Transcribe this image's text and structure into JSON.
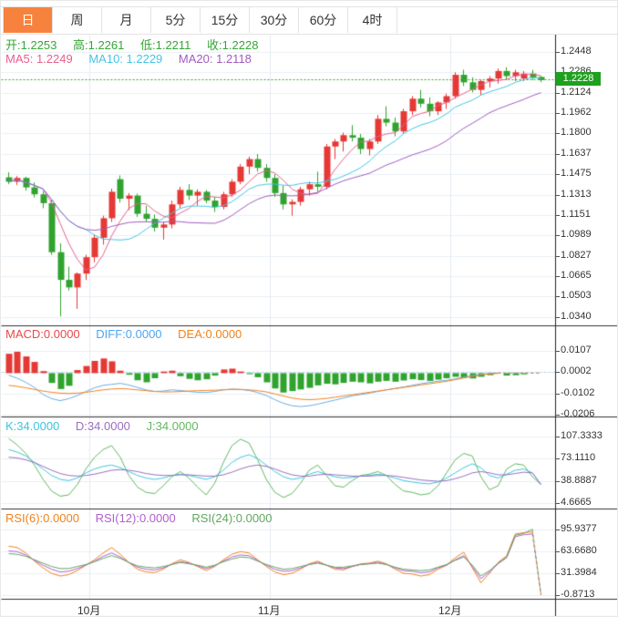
{
  "tabs": [
    {
      "label": "日",
      "active": true
    },
    {
      "label": "周",
      "active": false
    },
    {
      "label": "月",
      "active": false
    },
    {
      "label": "5分",
      "active": false
    },
    {
      "label": "15分",
      "active": false
    },
    {
      "label": "30分",
      "active": false
    },
    {
      "label": "60分",
      "active": false
    },
    {
      "label": "4时",
      "active": false
    }
  ],
  "info": {
    "open": "开:1.2253",
    "high": "高:1.2261",
    "low": "低:1.2211",
    "close": "收:1.2228",
    "ma5": "MA5: 1.2249",
    "ma10": "MA10: 1.2229",
    "ma20": "MA20: 1.2118"
  },
  "price_badge": "1.2228",
  "colors": {
    "up": "#e53935",
    "down": "#30a32f",
    "ma5": "#e8608e",
    "ma10": "#45c5e5",
    "ma20": "#a05bc0",
    "diff": "#6aabe8",
    "dea": "#f0821e",
    "k": "#3ec6dd",
    "d": "#9a6ec0",
    "j": "#61b861",
    "rsi6": "#f0821e",
    "rsi12": "#b05fd0",
    "rsi24": "#61a861",
    "grid": "#e9eff5",
    "vgrid": "#e4ebf2",
    "separator": "#333333",
    "axis_line": "#222222",
    "price_line": "#2ca52c",
    "badge": "#1fa01f",
    "tab_active": "#f7823e"
  },
  "chart_data": [
    {
      "type": "candlestick",
      "name": "price-panel",
      "y_axis_labels": [
        "1.2448",
        "1.2286",
        "1.2124",
        "1.1962",
        "1.1800",
        "1.1637",
        "1.1475",
        "1.1313",
        "1.1151",
        "1.0989",
        "1.0827",
        "1.0665",
        "1.0503",
        "1.0340"
      ],
      "ylim": [
        1.034,
        1.2448
      ],
      "current_price": 1.2228,
      "ma_periods": [
        5,
        10,
        20
      ],
      "x_ticks": [
        {
          "index": 10,
          "label": "10月"
        },
        {
          "index": 31,
          "label": "11月"
        },
        {
          "index": 52,
          "label": "12月"
        }
      ],
      "candles": [
        [
          1.1455,
          1.1495,
          1.14,
          1.142
        ],
        [
          1.142,
          1.1465,
          1.1395,
          1.145
        ],
        [
          1.145,
          1.146,
          1.135,
          1.1375
        ],
        [
          1.1375,
          1.1415,
          1.1295,
          1.132
        ],
        [
          1.132,
          1.1345,
          1.121,
          1.125
        ],
        [
          1.125,
          1.1275,
          1.0838,
          1.086
        ],
        [
          1.086,
          1.093,
          1.035,
          1.064
        ],
        [
          1.064,
          1.0745,
          1.0555,
          1.058
        ],
        [
          1.058,
          1.07,
          1.041,
          1.069
        ],
        [
          1.069,
          1.084,
          1.064,
          1.082
        ],
        [
          1.082,
          1.1,
          1.078,
          1.0975
        ],
        [
          1.0975,
          1.115,
          1.092,
          1.113
        ],
        [
          1.113,
          1.1365,
          1.11,
          1.134
        ],
        [
          1.144,
          1.147,
          1.1255,
          1.1285
        ],
        [
          1.1285,
          1.133,
          1.1195,
          1.131
        ],
        [
          1.131,
          1.1325,
          1.114,
          1.1165
        ],
        [
          1.1165,
          1.123,
          1.11,
          1.1125
        ],
        [
          1.1125,
          1.116,
          1.1025,
          1.1055
        ],
        [
          1.1055,
          1.11,
          1.096,
          1.108
        ],
        [
          1.108,
          1.127,
          1.105,
          1.124
        ],
        [
          1.124,
          1.138,
          1.121,
          1.1355
        ],
        [
          1.1355,
          1.14,
          1.1275,
          1.131
        ],
        [
          1.131,
          1.136,
          1.123,
          1.134
        ],
        [
          1.134,
          1.1355,
          1.125,
          1.127
        ],
        [
          1.127,
          1.13,
          1.118,
          1.122
        ],
        [
          1.122,
          1.134,
          1.12,
          1.132
        ],
        [
          1.132,
          1.144,
          1.13,
          1.142
        ],
        [
          1.142,
          1.156,
          1.14,
          1.154
        ],
        [
          1.154,
          1.162,
          1.148,
          1.16
        ],
        [
          1.16,
          1.164,
          1.15,
          1.153
        ],
        [
          1.153,
          1.156,
          1.142,
          1.145
        ],
        [
          1.145,
          1.148,
          1.13,
          1.133
        ],
        [
          1.133,
          1.139,
          1.12,
          1.124
        ],
        [
          1.124,
          1.128,
          1.115,
          1.126
        ],
        [
          1.126,
          1.138,
          1.123,
          1.136
        ],
        [
          1.136,
          1.142,
          1.131,
          1.14
        ],
        [
          1.14,
          1.15,
          1.134,
          1.138
        ],
        [
          1.138,
          1.172,
          1.136,
          1.17
        ],
        [
          1.17,
          1.176,
          1.16,
          1.174
        ],
        [
          1.174,
          1.181,
          1.166,
          1.179
        ],
        [
          1.179,
          1.187,
          1.174,
          1.177
        ],
        [
          1.177,
          1.18,
          1.164,
          1.168
        ],
        [
          1.168,
          1.176,
          1.163,
          1.174
        ],
        [
          1.174,
          1.195,
          1.172,
          1.192
        ],
        [
          1.192,
          1.202,
          1.186,
          1.189
        ],
        [
          1.189,
          1.193,
          1.178,
          1.182
        ],
        [
          1.182,
          1.2,
          1.18,
          1.198
        ],
        [
          1.198,
          1.21,
          1.195,
          1.208
        ],
        [
          1.208,
          1.215,
          1.201,
          1.204
        ],
        [
          1.204,
          1.209,
          1.194,
          1.198
        ],
        [
          1.198,
          1.206,
          1.195,
          1.205
        ],
        [
          1.205,
          1.212,
          1.2,
          1.21
        ],
        [
          1.21,
          1.229,
          1.208,
          1.227
        ],
        [
          1.227,
          1.231,
          1.218,
          1.221
        ],
        [
          1.221,
          1.225,
          1.213,
          1.215
        ],
        [
          1.215,
          1.223,
          1.211,
          1.222
        ],
        [
          1.222,
          1.226,
          1.217,
          1.224
        ],
        [
          1.224,
          1.232,
          1.22,
          1.23
        ],
        [
          1.23,
          1.233,
          1.223,
          1.226
        ],
        [
          1.226,
          1.231,
          1.222,
          1.229
        ],
        [
          1.224,
          1.23,
          1.222,
          1.228
        ],
        [
          1.228,
          1.231,
          1.223,
          1.225
        ],
        [
          1.2253,
          1.2261,
          1.2211,
          1.2228
        ]
      ]
    },
    {
      "type": "bar",
      "name": "macd-panel",
      "header": {
        "macd": "MACD:0.0000",
        "diff": "DIFF:0.0000",
        "dea": "DEA:0.0000"
      },
      "y_axis_labels": [
        "0.0107",
        "0.0002",
        "-0.0102",
        "-0.0206"
      ],
      "ylim": [
        -0.0206,
        0.0107
      ],
      "hist": [
        0.0095,
        0.0105,
        0.0082,
        0.0055,
        0.001,
        -0.0048,
        -0.0078,
        -0.0062,
        0.0015,
        0.0035,
        0.006,
        0.0072,
        0.0058,
        0.0012,
        -0.0008,
        -0.0035,
        -0.0045,
        -0.0025,
        0.0008,
        0.0012,
        -0.0015,
        -0.0028,
        -0.0035,
        -0.003,
        -0.0012,
        0.0018,
        0.0022,
        0.0008,
        -0.0005,
        -0.002,
        -0.0045,
        -0.0075,
        -0.0095,
        -0.0088,
        -0.008,
        -0.0072,
        -0.006,
        -0.0052,
        -0.0055,
        -0.0048,
        -0.0042,
        -0.0045,
        -0.005,
        -0.0042,
        -0.0038,
        -0.0042,
        -0.0036,
        -0.003,
        -0.0034,
        -0.0038,
        -0.0032,
        -0.0025,
        -0.0018,
        -0.0022,
        -0.0026,
        -0.0018,
        -0.001,
        0.0,
        -0.0012,
        -0.001,
        -0.0006,
        0.0,
        0.0
      ],
      "diff": [
        -0.001,
        -0.0025,
        -0.0045,
        -0.007,
        -0.0105,
        -0.0125,
        -0.0135,
        -0.0125,
        -0.011,
        -0.009,
        -0.0072,
        -0.006,
        -0.0055,
        -0.005,
        -0.0058,
        -0.007,
        -0.0082,
        -0.009,
        -0.0088,
        -0.0082,
        -0.0085,
        -0.009,
        -0.0094,
        -0.0095,
        -0.009,
        -0.0082,
        -0.0078,
        -0.008,
        -0.0085,
        -0.0095,
        -0.011,
        -0.013,
        -0.0148,
        -0.016,
        -0.0164,
        -0.016,
        -0.0152,
        -0.0142,
        -0.0132,
        -0.0122,
        -0.0112,
        -0.0105,
        -0.0098,
        -0.009,
        -0.0082,
        -0.0075,
        -0.0068,
        -0.006,
        -0.0052,
        -0.0045,
        -0.004,
        -0.0035,
        -0.0028,
        -0.002,
        -0.0012,
        -0.0006,
        -0.0002,
        0.0,
        0.0,
        0.0,
        0.0,
        0.0,
        0.0
      ],
      "dea": [
        -0.006,
        -0.0065,
        -0.0072,
        -0.008,
        -0.0088,
        -0.0094,
        -0.0098,
        -0.01,
        -0.0098,
        -0.0094,
        -0.0088,
        -0.0082,
        -0.0078,
        -0.0076,
        -0.0078,
        -0.0082,
        -0.0086,
        -0.009,
        -0.0092,
        -0.0092,
        -0.009,
        -0.0088,
        -0.0086,
        -0.0085,
        -0.0084,
        -0.0082,
        -0.008,
        -0.008,
        -0.0082,
        -0.0086,
        -0.0092,
        -0.0102,
        -0.0112,
        -0.0122,
        -0.0128,
        -0.013,
        -0.0128,
        -0.0124,
        -0.0118,
        -0.0112,
        -0.0106,
        -0.01,
        -0.0094,
        -0.0088,
        -0.0082,
        -0.0076,
        -0.007,
        -0.0064,
        -0.0058,
        -0.0052,
        -0.0046,
        -0.004,
        -0.0032,
        -0.0024,
        -0.0016,
        -0.0009,
        -0.0004,
        -0.0001,
        0.0,
        0.0,
        0.0,
        0.0,
        0.0
      ]
    },
    {
      "type": "line",
      "name": "kdj-panel",
      "header": {
        "k": "K:34.0000",
        "d": "D:34.0000",
        "j": "J:34.0000"
      },
      "y_axis_labels": [
        "107.3333",
        "73.1110",
        "38.8887",
        "4.6665"
      ],
      "ylim": [
        4.6665,
        107.3333
      ],
      "k": [
        88,
        84,
        78,
        68,
        58,
        48,
        42,
        40,
        44,
        52,
        58,
        62,
        64,
        60,
        54,
        48,
        44,
        42,
        44,
        48,
        50,
        48,
        45,
        42,
        46,
        56,
        68,
        76,
        80,
        74,
        64,
        54,
        46,
        42,
        44,
        50,
        54,
        50,
        46,
        44,
        45,
        47,
        48,
        50,
        48,
        44,
        40,
        38,
        36,
        35,
        38,
        44,
        52,
        60,
        66,
        60,
        48,
        44,
        50,
        56,
        58,
        52,
        34
      ],
      "d": [
        76,
        75,
        72,
        68,
        62,
        56,
        51,
        48,
        47,
        48,
        50,
        53,
        56,
        57,
        56,
        54,
        51,
        49,
        48,
        48,
        49,
        49,
        48,
        47,
        47,
        49,
        53,
        58,
        62,
        64,
        62,
        58,
        53,
        49,
        47,
        47,
        49,
        50,
        49,
        48,
        47,
        47,
        47,
        48,
        48,
        47,
        45,
        43,
        41,
        40,
        39,
        40,
        43,
        47,
        52,
        54,
        52,
        49,
        49,
        51,
        53,
        52,
        34
      ],
      "j": [
        105,
        95,
        82,
        64,
        42,
        24,
        16,
        18,
        34,
        58,
        76,
        88,
        94,
        76,
        48,
        30,
        22,
        20,
        32,
        46,
        54,
        44,
        30,
        18,
        36,
        68,
        94,
        104,
        98,
        72,
        42,
        22,
        14,
        20,
        36,
        56,
        64,
        48,
        32,
        30,
        40,
        48,
        50,
        54,
        48,
        34,
        24,
        22,
        18,
        20,
        32,
        52,
        72,
        82,
        78,
        46,
        26,
        32,
        58,
        66,
        64,
        46,
        34
      ]
    },
    {
      "type": "line",
      "name": "rsi-panel",
      "header": {
        "rsi6": "RSI(6):0.0000",
        "rsi12": "RSI(12):0.0000",
        "rsi24": "RSI(24):0.0000"
      },
      "y_axis_labels": [
        "95.9377",
        "63.6680",
        "31.3984",
        "-0.8713"
      ],
      "ylim": [
        -0.8713,
        95.9377
      ],
      "rsi6": [
        72,
        70,
        62,
        50,
        40,
        32,
        28,
        30,
        36,
        44,
        52,
        62,
        70,
        60,
        48,
        38,
        34,
        33,
        38,
        46,
        52,
        48,
        42,
        36,
        42,
        52,
        60,
        64,
        62,
        52,
        42,
        34,
        30,
        32,
        38,
        46,
        50,
        44,
        38,
        37,
        42,
        46,
        47,
        50,
        46,
        38,
        32,
        31,
        28,
        30,
        38,
        44,
        55,
        63,
        40,
        18,
        32,
        48,
        58,
        90,
        92,
        93,
        0
      ],
      "rsi12": [
        65,
        64,
        59,
        51,
        44,
        38,
        34,
        35,
        39,
        44,
        50,
        57,
        62,
        56,
        48,
        41,
        38,
        37,
        40,
        45,
        49,
        47,
        43,
        39,
        43,
        50,
        56,
        59,
        58,
        51,
        44,
        38,
        35,
        36,
        40,
        45,
        48,
        44,
        40,
        39,
        42,
        45,
        46,
        48,
        45,
        40,
        36,
        35,
        33,
        34,
        40,
        44,
        52,
        58,
        42,
        24,
        34,
        46,
        55,
        86,
        89,
        90,
        0
      ],
      "rsi24": [
        61,
        60,
        57,
        52,
        47,
        42,
        39,
        39,
        42,
        45,
        49,
        54,
        58,
        54,
        48,
        43,
        41,
        40,
        42,
        45,
        48,
        46,
        44,
        41,
        44,
        49,
        53,
        56,
        55,
        50,
        45,
        41,
        38,
        39,
        42,
        45,
        47,
        44,
        41,
        41,
        43,
        45,
        46,
        47,
        45,
        41,
        38,
        37,
        36,
        37,
        41,
        45,
        51,
        56,
        44,
        28,
        36,
        47,
        56,
        88,
        91,
        97,
        0
      ]
    }
  ],
  "x_axis": {
    "labels": [
      "10月",
      "11月",
      "12月"
    ]
  }
}
